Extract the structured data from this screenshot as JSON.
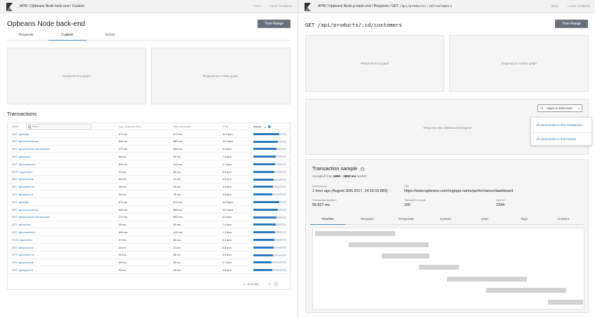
{
  "left": {
    "breadcrumb": "APM / Opbeans Node back-end / Custom",
    "top_links": [
      "Docs",
      "Leave feedback"
    ],
    "title": "Opbeans Node back-end",
    "time_range_label": "Time Range",
    "tabs": [
      {
        "label": "Requests"
      },
      {
        "label": "Custom"
      },
      {
        "label": "Errors"
      }
    ],
    "graphs": {
      "response_time": "Response time graph",
      "requests_per_minute": "Requests per minute graph"
    },
    "transactions_title": "Transactions",
    "table": {
      "col_name": "Name",
      "filter_placeholder": "Filter",
      "col_avg": "Avg. response time",
      "col_p95": "95th percentile",
      "col_tpm": "TPM",
      "col_impact": "Impact",
      "rows": [
        {
          "name": "GET /api/stats",
          "avg": "571 ms",
          "p95": "670 ms",
          "tpm": "11.5 tpm",
          "impact": 0.78
        },
        {
          "name": "GET /api/products/top",
          "avg": "543 ms",
          "p95": "665 ms",
          "tpm": "10.3 tpm",
          "impact": 0.74
        },
        {
          "name": "GET /api/products/:id/customers",
          "avg": "277 ms",
          "p95": "963 ms",
          "tpm": "5.0 tpm",
          "impact": 0.7
        },
        {
          "name": "GET /api/orders",
          "avg": "58 ms",
          "p95": "90 ms",
          "tpm": "7.4 tpm",
          "impact": 0.68
        },
        {
          "name": "GET /api/customers",
          "avg": "304 ms",
          "p95": "413 ms",
          "tpm": "1.1 tpm",
          "impact": 0.66
        },
        {
          "name": "POST /api/orders",
          "avg": "57 ms",
          "p95": "89 ms",
          "tpm": "5.4 tpm",
          "impact": 0.64
        },
        {
          "name": "GET /api/products",
          "avg": "20 ms",
          "p95": "21 ms",
          "tpm": "6.5 tpm",
          "impact": 0.62
        },
        {
          "name": "GET /api/orders/:id",
          "avg": "25 ms",
          "p95": "26 ms",
          "tpm": "4.9 tpm",
          "impact": 0.6
        },
        {
          "name": "GET /api/types/:id",
          "avg": "25 ms",
          "p95": "26 ms",
          "tpm": "4.8 tpm",
          "impact": 0.58
        },
        {
          "name": "GET /api/stats",
          "avg": "571 ms",
          "p95": "670 ms",
          "tpm": "11.5 tpm",
          "impact": 0.78
        },
        {
          "name": "GET /api/products/top",
          "avg": "543 ms",
          "p95": "665 ms",
          "tpm": "10.3 tpm",
          "impact": 0.74
        },
        {
          "name": "GET /api/products/:id/customers",
          "avg": "277 ms",
          "p95": "963 ms",
          "tpm": "5.0 tpm",
          "impact": 0.7
        },
        {
          "name": "GET /api/orders",
          "avg": "58 ms",
          "p95": "90 ms",
          "tpm": "7.4 tpm",
          "impact": 0.68
        },
        {
          "name": "GET /api/customers",
          "avg": "304 ms",
          "p95": "413 ms",
          "tpm": "1.1 tpm",
          "impact": 0.66
        },
        {
          "name": "POST /api/orders",
          "avg": "57 ms",
          "p95": "89 ms",
          "tpm": "5.4 tpm",
          "impact": 0.64
        },
        {
          "name": "GET /api/products",
          "avg": "20 ms",
          "p95": "21 ms",
          "tpm": "6.5 tpm",
          "impact": 0.62
        },
        {
          "name": "GET /api/orders/:id",
          "avg": "25 ms",
          "p95": "26 ms",
          "tpm": "4.9 tpm",
          "impact": 0.6
        },
        {
          "name": "GET /api/products",
          "avg": "45 ms",
          "p95": "30 ms",
          "tpm": "2.7 tpm",
          "impact": 0.56
        },
        {
          "name": "GET /api/types/:id",
          "avg": "25 ms",
          "p95": "26 ms",
          "tpm": "4.8 tpm",
          "impact": 0.58
        }
      ],
      "pagination": "1 - 25 of 100",
      "page": "1"
    }
  },
  "right": {
    "breadcrumb_prefix": "APM / Opbeans Node.js back-end / Requests / GET ",
    "breadcrumb_path": "/api/products/:id/customers",
    "top_links": [
      "Docs",
      "Leave feedback"
    ],
    "title": "GET /api/products/:id/customers",
    "time_range_label": "Time Range",
    "graphs": {
      "response_time": "Response time graph",
      "requests_per_minute": "Requests per minute graph"
    },
    "distribution_label": "Response time distribution histogram",
    "discover_button": "Open in Discover",
    "popover": {
      "item1": "All documents in this transaction",
      "item2": "All documents in this bucket"
    },
    "sample": {
      "title": "Transaction sample",
      "sub_prefix": "Sampled from ",
      "sub_range": "1650 - 1800 ms",
      "sub_suffix": " bucket",
      "timestamp_label": "@timestamp",
      "timestamp_value": "1 hour ago (August 30th 2017, 14:16:15.883)",
      "url_label": "URL",
      "url_value": "https://www.opbeans.com/org/app-name/performance/dashboard",
      "duration_label": "Transaction duration",
      "duration_value": "56,827 ms",
      "result_label": "Transaction result",
      "result_value": "200",
      "userid_label": "User ID",
      "userid_value": "2344",
      "tabs": [
        {
          "label": "Timeline"
        },
        {
          "label": "Request"
        },
        {
          "label": "Response"
        },
        {
          "label": "System"
        },
        {
          "label": "User"
        },
        {
          "label": "Tags"
        },
        {
          "label": "Custom"
        }
      ]
    }
  },
  "colors": {
    "accent": "#2b78be",
    "link": "#2a77b6",
    "button": "#6a717d",
    "panel": "#f5f5f5"
  }
}
